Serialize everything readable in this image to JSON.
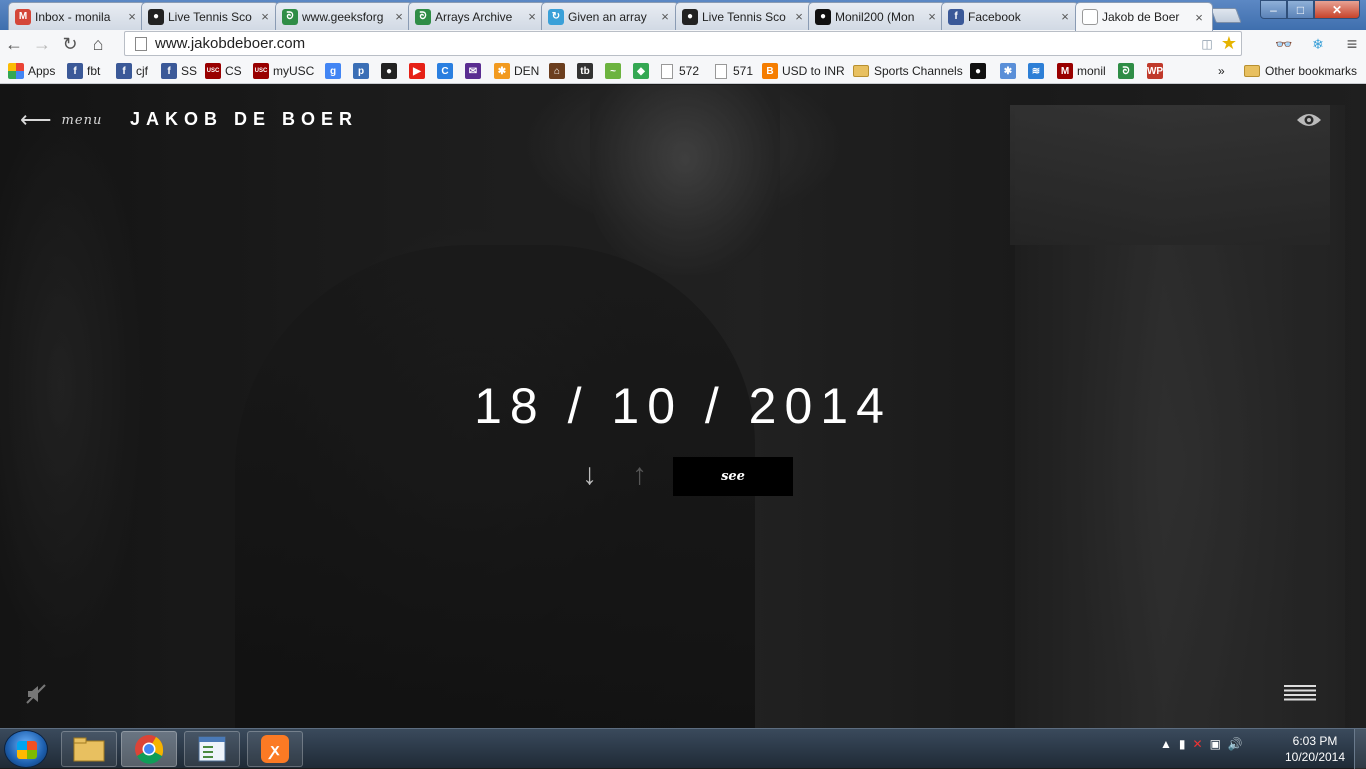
{
  "browser": {
    "tabs": [
      {
        "title": "Inbox - monila",
        "icon": "gmail-icon",
        "color": "#d44638",
        "glyph": "M"
      },
      {
        "title": "Live Tennis Sco",
        "icon": "tennis-icon",
        "color": "#222222",
        "glyph": "●"
      },
      {
        "title": "www.geeksforg",
        "icon": "geeksforgeeks-icon",
        "color": "#2f8d46",
        "glyph": "ᘐ"
      },
      {
        "title": "Arrays Archive",
        "icon": "geeksforgeeks-icon",
        "color": "#2f8d46",
        "glyph": "ᘐ"
      },
      {
        "title": "Given an array",
        "icon": "loading-icon",
        "color": "#3aa0d8",
        "glyph": "↻"
      },
      {
        "title": "Live Tennis Sco",
        "icon": "tennis-icon",
        "color": "#222222",
        "glyph": "●"
      },
      {
        "title": "Monil200 (Mon",
        "icon": "github-icon",
        "color": "#111111",
        "glyph": "●"
      },
      {
        "title": "Facebook",
        "icon": "facebook-icon",
        "color": "#3b5998",
        "glyph": "f"
      },
      {
        "title": "Jakob de Boer",
        "icon": "page-icon",
        "color": "#ffffff",
        "glyph": ""
      }
    ],
    "tab_close_glyph": "×",
    "window_buttons": {
      "minimize": "–",
      "maximize": "□",
      "close": "✕"
    },
    "nav": {
      "back": "←",
      "forward": "→",
      "reload": "↻",
      "home": "⌂"
    },
    "url": "www.jakobdeboer.com",
    "bookmarks": [
      {
        "label": "Apps",
        "kind": "apps"
      },
      {
        "label": "fbt",
        "kind": "icon",
        "color": "#3b5998",
        "glyph": "f"
      },
      {
        "label": "cjf",
        "kind": "icon",
        "color": "#3b5998",
        "glyph": "f"
      },
      {
        "label": "SS",
        "kind": "icon",
        "color": "#3b5998",
        "glyph": "f"
      },
      {
        "label": "CS",
        "kind": "icon",
        "color": "#990000",
        "glyph": "USC"
      },
      {
        "label": "myUSC",
        "kind": "icon",
        "color": "#990000",
        "glyph": "USC"
      },
      {
        "label": "",
        "kind": "icon",
        "color": "#4285f4",
        "glyph": "g"
      },
      {
        "label": "",
        "kind": "icon",
        "color": "#3b6fb6",
        "glyph": "p"
      },
      {
        "label": "",
        "kind": "icon",
        "color": "#222222",
        "glyph": "●"
      },
      {
        "label": "",
        "kind": "icon",
        "color": "#e62117",
        "glyph": "▶"
      },
      {
        "label": "",
        "kind": "icon",
        "color": "#2a7fe0",
        "glyph": "C"
      },
      {
        "label": "",
        "kind": "icon",
        "color": "#5a2d91",
        "glyph": "✉"
      },
      {
        "label": "DEN",
        "kind": "icon",
        "color": "#f29a1f",
        "glyph": "✱"
      },
      {
        "label": "",
        "kind": "icon",
        "color": "#6b3e1e",
        "glyph": "⌂"
      },
      {
        "label": "",
        "kind": "icon",
        "color": "#333333",
        "glyph": "tb"
      },
      {
        "label": "",
        "kind": "icon",
        "color": "#6cb33f",
        "glyph": "~"
      },
      {
        "label": "",
        "kind": "icon",
        "color": "#34a853",
        "glyph": "◆"
      },
      {
        "label": "572",
        "kind": "doc"
      },
      {
        "label": "571",
        "kind": "doc"
      },
      {
        "label": "USD to INR",
        "kind": "icon",
        "color": "#f57d00",
        "glyph": "B"
      },
      {
        "label": "Sports Channels",
        "kind": "folder"
      },
      {
        "label": "",
        "kind": "icon",
        "color": "#111111",
        "glyph": "●"
      },
      {
        "label": "",
        "kind": "icon",
        "color": "#5a8fd8",
        "glyph": "✱"
      },
      {
        "label": "",
        "kind": "icon",
        "color": "#2d7fd6",
        "glyph": "≋"
      },
      {
        "label": "monil",
        "kind": "icon",
        "color": "#990000",
        "glyph": "M"
      },
      {
        "label": "",
        "kind": "icon",
        "color": "#2f8d46",
        "glyph": "ᘐ"
      },
      {
        "label": "",
        "kind": "icon",
        "color": "#c0392b",
        "glyph": "WP"
      }
    ],
    "bookmarks_overflow": "»",
    "other_bookmarks": "Other bookmarks"
  },
  "site": {
    "menu_arrow": "⟵",
    "menu_label": "menu",
    "title": "JAKOB DE BOER",
    "date": "18 / 10 / 2014",
    "arrow_down": "↓",
    "arrow_up": "↑",
    "see_label": "see"
  },
  "taskbar": {
    "apps": [
      {
        "name": "explorer-app",
        "active": false
      },
      {
        "name": "chrome-app",
        "active": true
      },
      {
        "name": "notepad-app",
        "active": false
      },
      {
        "name": "xampp-app",
        "active": false
      }
    ],
    "tray": [
      "▲",
      "▮",
      "✕",
      "▣",
      "🔊"
    ],
    "time": "6:03 PM",
    "date": "10/20/2014"
  }
}
